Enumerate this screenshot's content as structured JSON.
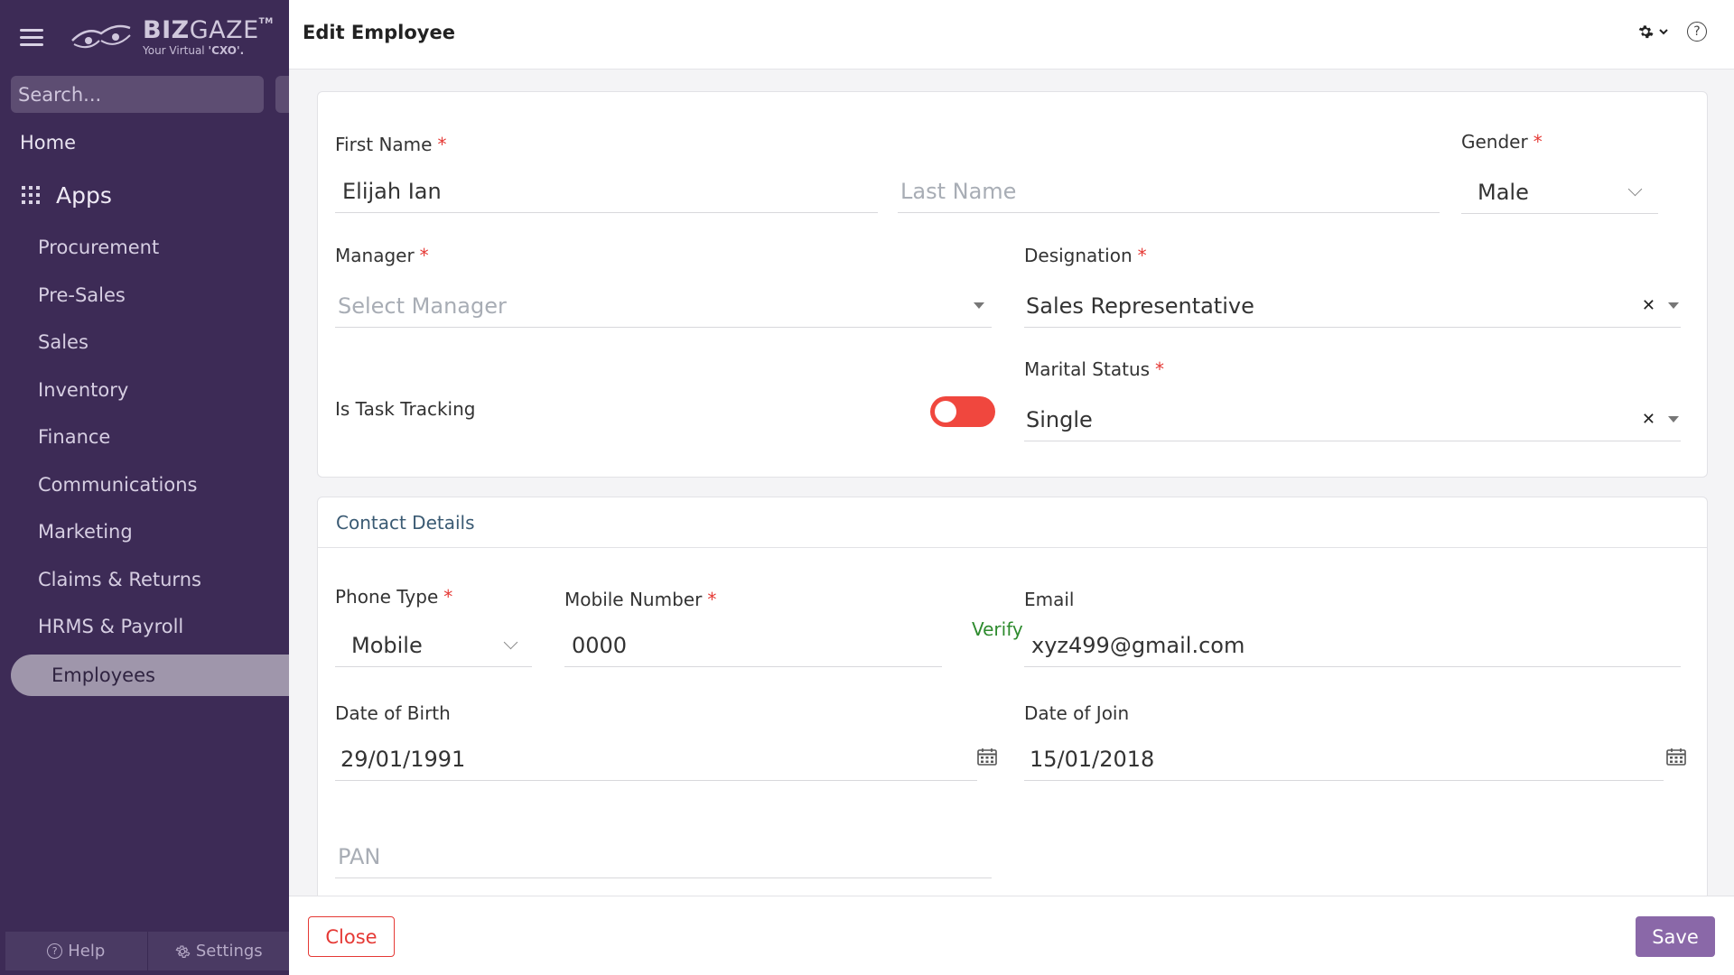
{
  "sidebar": {
    "logo_title_bold": "BIZ",
    "logo_title_light": "GAZE",
    "logo_tm": "TM",
    "logo_sub_prefix": "Your Virtual ",
    "logo_sub_bold": "'CXO'.",
    "search_placeholder": "Search...",
    "home": "Home",
    "apps": "Apps",
    "items": [
      {
        "label": "Procurement"
      },
      {
        "label": "Pre-Sales"
      },
      {
        "label": "Sales"
      },
      {
        "label": "Inventory"
      },
      {
        "label": "Finance"
      },
      {
        "label": "Communications"
      },
      {
        "label": "Marketing"
      },
      {
        "label": "Claims & Returns"
      },
      {
        "label": "HRMS & Payroll"
      }
    ],
    "active_item": "Employees",
    "help": "Help",
    "settings": "Settings"
  },
  "header": {
    "title": "Edit Employee",
    "help_glyph": "?"
  },
  "form": {
    "required_mark": "*",
    "first_name": {
      "label": "First Name",
      "value": "Elijah Ian"
    },
    "last_name": {
      "placeholder": "Last Name"
    },
    "gender": {
      "label": "Gender",
      "value": "Male"
    },
    "manager": {
      "label": "Manager",
      "placeholder": "Select Manager"
    },
    "designation": {
      "label": "Designation",
      "value": "Sales Representative"
    },
    "task_tracking": {
      "label": "Is Task Tracking",
      "value": "off"
    },
    "marital_status": {
      "label": "Marital Status",
      "value": "Single"
    },
    "clear_glyph": "✕"
  },
  "contact": {
    "section_title": "Contact Details",
    "phone_type": {
      "label": "Phone Type",
      "value": "Mobile"
    },
    "mobile": {
      "label": "Mobile Number",
      "value": "0000",
      "verify": "Verify"
    },
    "email": {
      "label": "Email",
      "value": "xyz499@gmail.com"
    },
    "dob": {
      "label": "Date of Birth",
      "value": "29/01/1991"
    },
    "doj": {
      "label": "Date of Join",
      "value": "15/01/2018"
    },
    "pan": {
      "placeholder": "PAN"
    }
  },
  "footer": {
    "close": "Close",
    "save": "Save"
  },
  "colors": {
    "sidebar_bg": "#3d2b56",
    "accent": "#8a68a8",
    "danger": "#e53935",
    "toggle": "#f0473e",
    "verify": "#2e8b2e"
  }
}
